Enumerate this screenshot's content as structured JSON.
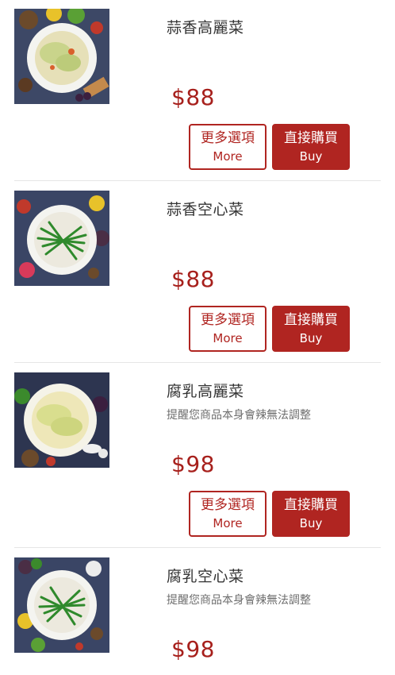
{
  "labels": {
    "more_zh": "更多選項",
    "more_en": "More",
    "buy_zh": "直接購買",
    "buy_en": "Buy"
  },
  "items": [
    {
      "name": "蒜香高麗菜",
      "note": "",
      "price": "$88"
    },
    {
      "name": "蒜香空心菜",
      "note": "",
      "price": "$88"
    },
    {
      "name": "腐乳高麗菜",
      "note": "提醒您商品本身會辣無法調整",
      "price": "$98"
    },
    {
      "name": "腐乳空心菜",
      "note": "提醒您商品本身會辣無法調整",
      "price": "$98"
    }
  ],
  "colors": {
    "accent": "#b02521",
    "price": "#a7201c"
  },
  "icons": {
    "dish": "dish-photo"
  }
}
